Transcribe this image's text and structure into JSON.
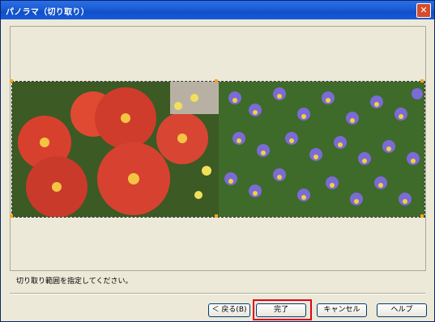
{
  "window": {
    "title": "パノラマ（切り取り）",
    "close_icon": "close-icon"
  },
  "image": {
    "description_icon": "panorama-image"
  },
  "status_text": "切り取り範囲を指定してください。",
  "buttons": {
    "back": "＜ 戻る(B)",
    "finish": "完了",
    "cancel": "キャンセル",
    "help": "ヘルプ"
  },
  "colors": {
    "title_bar": "#1e5ed6",
    "highlight": "#e3001b"
  }
}
